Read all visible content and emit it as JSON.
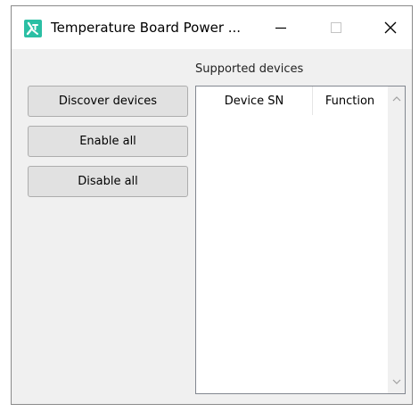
{
  "window": {
    "title": "Temperature Board Power ...",
    "controls": {
      "minimize_icon": "minimize-icon",
      "maximize_icon": "maximize-icon",
      "close_icon": "close-icon"
    }
  },
  "actions": {
    "discover_label": "Discover devices",
    "enable_all_label": "Enable all",
    "disable_all_label": "Disable all"
  },
  "devices": {
    "group_label": "Supported devices",
    "columns": [
      "Device SN",
      "Function"
    ],
    "rows": []
  },
  "colors": {
    "app_icon_accent": "#2bbfa4",
    "window_background": "#f0f0f0",
    "button_background": "#e1e1e1"
  }
}
